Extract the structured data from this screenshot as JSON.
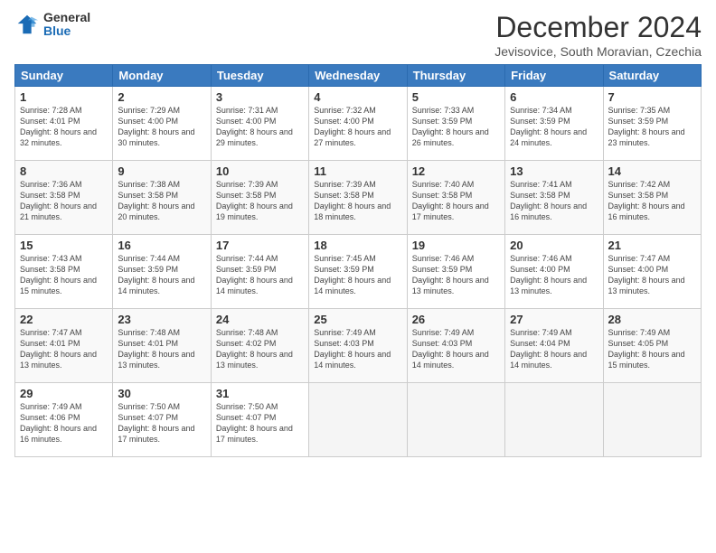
{
  "logo": {
    "general": "General",
    "blue": "Blue"
  },
  "header": {
    "month": "December 2024",
    "location": "Jevisovice, South Moravian, Czechia"
  },
  "days": [
    "Sunday",
    "Monday",
    "Tuesday",
    "Wednesday",
    "Thursday",
    "Friday",
    "Saturday"
  ],
  "weeks": [
    [
      {
        "day": "1",
        "sunrise": "7:28 AM",
        "sunset": "4:01 PM",
        "daylight": "8 hours and 32 minutes."
      },
      {
        "day": "2",
        "sunrise": "7:29 AM",
        "sunset": "4:00 PM",
        "daylight": "8 hours and 30 minutes."
      },
      {
        "day": "3",
        "sunrise": "7:31 AM",
        "sunset": "4:00 PM",
        "daylight": "8 hours and 29 minutes."
      },
      {
        "day": "4",
        "sunrise": "7:32 AM",
        "sunset": "4:00 PM",
        "daylight": "8 hours and 27 minutes."
      },
      {
        "day": "5",
        "sunrise": "7:33 AM",
        "sunset": "3:59 PM",
        "daylight": "8 hours and 26 minutes."
      },
      {
        "day": "6",
        "sunrise": "7:34 AM",
        "sunset": "3:59 PM",
        "daylight": "8 hours and 24 minutes."
      },
      {
        "day": "7",
        "sunrise": "7:35 AM",
        "sunset": "3:59 PM",
        "daylight": "8 hours and 23 minutes."
      }
    ],
    [
      {
        "day": "8",
        "sunrise": "7:36 AM",
        "sunset": "3:58 PM",
        "daylight": "8 hours and 21 minutes."
      },
      {
        "day": "9",
        "sunrise": "7:38 AM",
        "sunset": "3:58 PM",
        "daylight": "8 hours and 20 minutes."
      },
      {
        "day": "10",
        "sunrise": "7:39 AM",
        "sunset": "3:58 PM",
        "daylight": "8 hours and 19 minutes."
      },
      {
        "day": "11",
        "sunrise": "7:39 AM",
        "sunset": "3:58 PM",
        "daylight": "8 hours and 18 minutes."
      },
      {
        "day": "12",
        "sunrise": "7:40 AM",
        "sunset": "3:58 PM",
        "daylight": "8 hours and 17 minutes."
      },
      {
        "day": "13",
        "sunrise": "7:41 AM",
        "sunset": "3:58 PM",
        "daylight": "8 hours and 16 minutes."
      },
      {
        "day": "14",
        "sunrise": "7:42 AM",
        "sunset": "3:58 PM",
        "daylight": "8 hours and 16 minutes."
      }
    ],
    [
      {
        "day": "15",
        "sunrise": "7:43 AM",
        "sunset": "3:58 PM",
        "daylight": "8 hours and 15 minutes."
      },
      {
        "day": "16",
        "sunrise": "7:44 AM",
        "sunset": "3:59 PM",
        "daylight": "8 hours and 14 minutes."
      },
      {
        "day": "17",
        "sunrise": "7:44 AM",
        "sunset": "3:59 PM",
        "daylight": "8 hours and 14 minutes."
      },
      {
        "day": "18",
        "sunrise": "7:45 AM",
        "sunset": "3:59 PM",
        "daylight": "8 hours and 14 minutes."
      },
      {
        "day": "19",
        "sunrise": "7:46 AM",
        "sunset": "3:59 PM",
        "daylight": "8 hours and 13 minutes."
      },
      {
        "day": "20",
        "sunrise": "7:46 AM",
        "sunset": "4:00 PM",
        "daylight": "8 hours and 13 minutes."
      },
      {
        "day": "21",
        "sunrise": "7:47 AM",
        "sunset": "4:00 PM",
        "daylight": "8 hours and 13 minutes."
      }
    ],
    [
      {
        "day": "22",
        "sunrise": "7:47 AM",
        "sunset": "4:01 PM",
        "daylight": "8 hours and 13 minutes."
      },
      {
        "day": "23",
        "sunrise": "7:48 AM",
        "sunset": "4:01 PM",
        "daylight": "8 hours and 13 minutes."
      },
      {
        "day": "24",
        "sunrise": "7:48 AM",
        "sunset": "4:02 PM",
        "daylight": "8 hours and 13 minutes."
      },
      {
        "day": "25",
        "sunrise": "7:49 AM",
        "sunset": "4:03 PM",
        "daylight": "8 hours and 14 minutes."
      },
      {
        "day": "26",
        "sunrise": "7:49 AM",
        "sunset": "4:03 PM",
        "daylight": "8 hours and 14 minutes."
      },
      {
        "day": "27",
        "sunrise": "7:49 AM",
        "sunset": "4:04 PM",
        "daylight": "8 hours and 14 minutes."
      },
      {
        "day": "28",
        "sunrise": "7:49 AM",
        "sunset": "4:05 PM",
        "daylight": "8 hours and 15 minutes."
      }
    ],
    [
      {
        "day": "29",
        "sunrise": "7:49 AM",
        "sunset": "4:06 PM",
        "daylight": "8 hours and 16 minutes."
      },
      {
        "day": "30",
        "sunrise": "7:50 AM",
        "sunset": "4:07 PM",
        "daylight": "8 hours and 17 minutes."
      },
      {
        "day": "31",
        "sunrise": "7:50 AM",
        "sunset": "4:07 PM",
        "daylight": "8 hours and 17 minutes."
      },
      null,
      null,
      null,
      null
    ]
  ]
}
